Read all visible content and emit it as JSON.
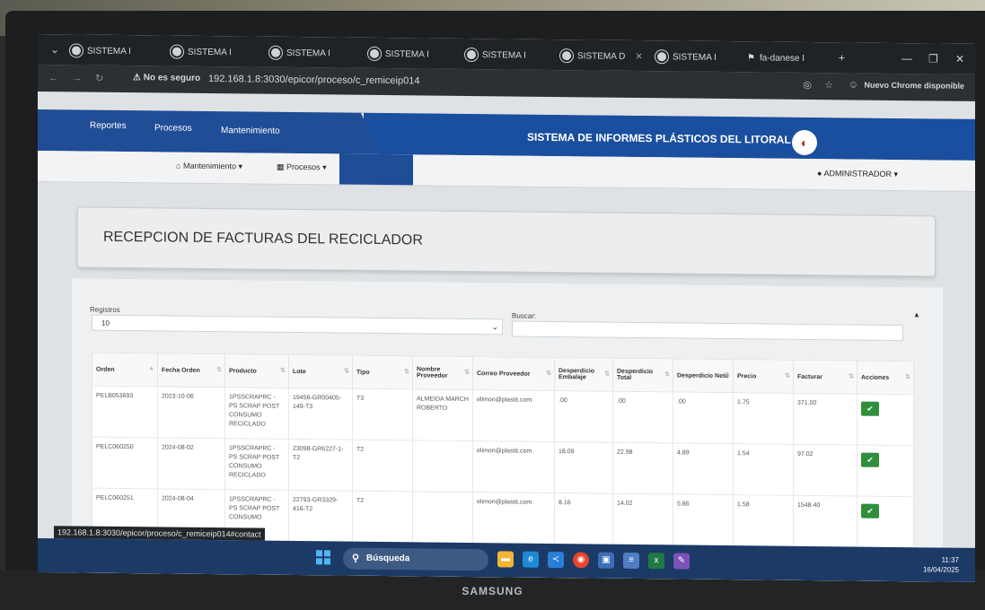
{
  "browser": {
    "tabs": [
      {
        "label": "SISTEMA I"
      },
      {
        "label": "SISTEMA I"
      },
      {
        "label": "SISTEMA I"
      },
      {
        "label": "SISTEMA I"
      },
      {
        "label": "SISTEMA I"
      },
      {
        "label": "SISTEMA D"
      },
      {
        "label": "SISTEMA I"
      },
      {
        "label": "fa-danese I"
      }
    ],
    "security_label": "No es seguro",
    "url": "192.168.1.8:3030/epicor/proceso/c_remiceip014",
    "update_notice": "Nuevo Chrome disponible"
  },
  "app": {
    "menu": [
      "Reportes",
      "Procesos",
      "Mantenimiento"
    ],
    "system_title": "SISTEMA DE INFORMES PLÁSTICOS DEL LITORAL",
    "submenu": [
      "Mantenimiento",
      "Procesos"
    ],
    "user": "ADMINISTRADOR"
  },
  "page": {
    "title": "RECEPCION DE FACTURAS DEL RECICLADOR",
    "records_label": "Registros",
    "records_value": "10",
    "search_label": "Buscar:"
  },
  "table": {
    "columns": [
      "Orden",
      "Fecha Orden",
      "Producto",
      "Lote",
      "Tipo",
      "Nombre Proveedor",
      "Correo Proveedor",
      "Desperdicio Embalaje",
      "Desperdicio Total",
      "Desperdicio Neto",
      "Precio",
      "Facturar",
      "Acciones"
    ],
    "rows": [
      {
        "orden": "PELB053693",
        "fecha": "2023-10-06",
        "producto": "1PSSCRAPRC - PS SCRAP POST CONSUMO RECICLADO",
        "lote": "19456-GR00405-149-T3",
        "tipo": "T3",
        "proveedor": "ALMEIDA MARCH ROBERTO",
        "correo": "elimon@plastit.com",
        "embalaje": ".00",
        "total": ".00",
        "neto": ".00",
        "precio": "1.75",
        "facturar": "371.00"
      },
      {
        "orden": "PELC060250",
        "fecha": "2024-08-02",
        "producto": "1PSSCRAPRC - PS SCRAP POST CONSUMO RECICLADO",
        "lote": "23098-GR6227-1-T2",
        "tipo": "T2",
        "proveedor": "",
        "correo": "elimon@plastit.com",
        "embalaje": "18.09",
        "total": "22.98",
        "neto": "4.89",
        "precio": "1.54",
        "facturar": "97.02"
      },
      {
        "orden": "PELC060251",
        "fecha": "2024-08-04",
        "producto": "1PSSCRAPRC - PS SCRAP POST CONSUMO",
        "lote": "22793-GR3329-416-T2",
        "tipo": "T2",
        "proveedor": "",
        "correo": "elimon@plastit.com",
        "embalaje": "8.16",
        "total": "14.02",
        "neto": "5.86",
        "precio": "1.58",
        "facturar": "1548.40"
      }
    ]
  },
  "status_url": "192.168.1.8:3030/epicor/proceso/c_remiceip014#contact",
  "taskbar": {
    "search": "Búsqueda",
    "time": "11:37",
    "date": "16/04/2025"
  },
  "monitor_brand": "SAMSUNG"
}
